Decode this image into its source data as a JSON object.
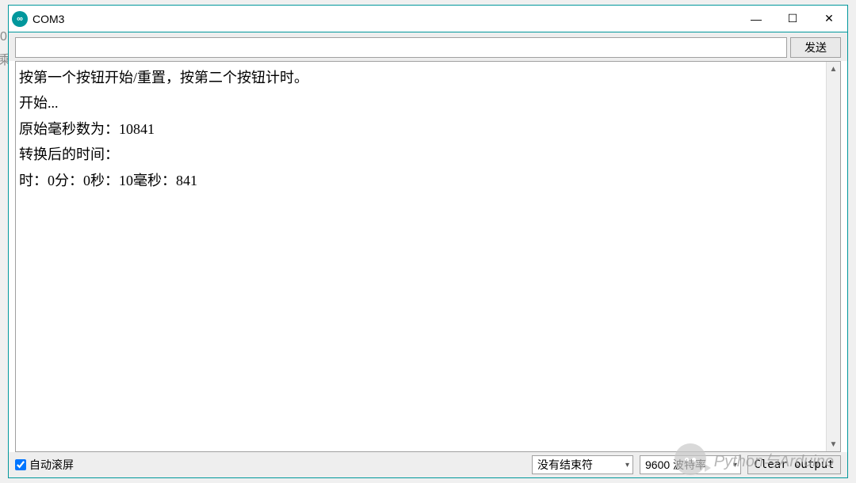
{
  "window": {
    "title": "COM3"
  },
  "send": {
    "value": "",
    "placeholder": "",
    "button": "发送"
  },
  "output_lines": [
    "按第一个按钮开始/重置，按第二个按钮计时。",
    "开始...",
    "原始毫秒数为：10841",
    "转换后的时间：",
    "时：0分：0秒：10毫秒：841"
  ],
  "bottom": {
    "autoscroll_label": "自动滚屏",
    "autoscroll_checked": true,
    "line_ending": "没有结束符",
    "baud": "9600 波特率",
    "clear": "Clear output"
  },
  "watermark": {
    "text": "Python与Arduino"
  },
  "bg": {
    "zero": "0",
    "deco": "乘"
  }
}
